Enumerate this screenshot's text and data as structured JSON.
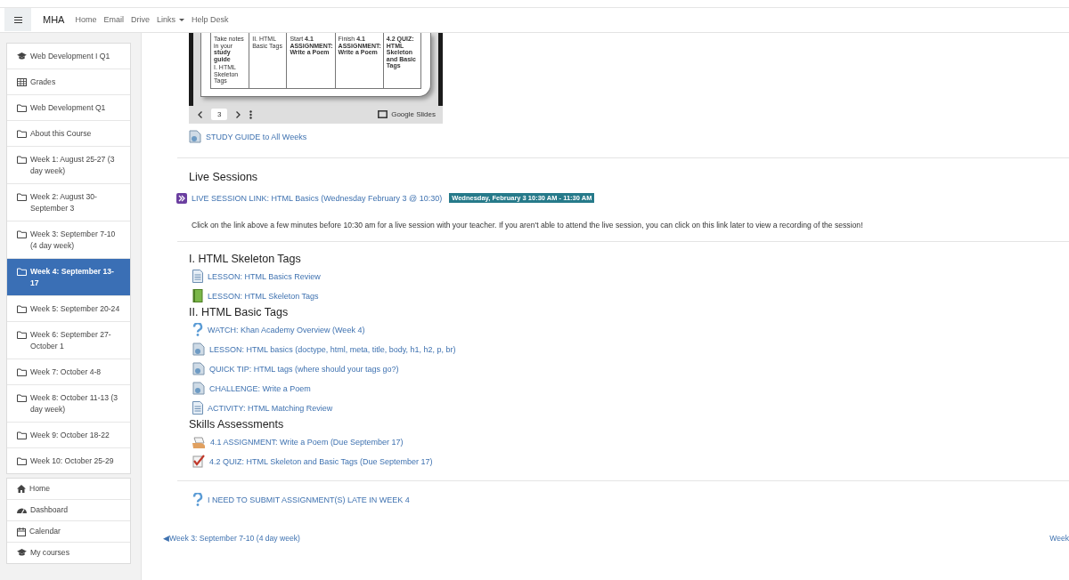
{
  "navbar": {
    "brand": "MHA",
    "links": [
      {
        "label": "Home",
        "dropdown": false
      },
      {
        "label": "Email",
        "dropdown": false
      },
      {
        "label": "Drive",
        "dropdown": false
      },
      {
        "label": "Links",
        "dropdown": true
      },
      {
        "label": "Help Desk",
        "dropdown": false
      }
    ]
  },
  "sidebar": {
    "course_items": [
      {
        "kind": "course",
        "label": "Web Development I Q1",
        "selected": false
      },
      {
        "kind": "grades",
        "label": "Grades",
        "selected": false
      },
      {
        "kind": "section",
        "label": "Web Development Q1",
        "selected": false
      },
      {
        "kind": "section",
        "label": "About this Course",
        "selected": false
      },
      {
        "kind": "section",
        "label": "Week 1: August 25-27 (3 day week)",
        "selected": false
      },
      {
        "kind": "section",
        "label": "Week 2: August 30-September 3",
        "selected": false
      },
      {
        "kind": "section",
        "label": "Week 3: September 7-10 (4 day week)",
        "selected": false
      },
      {
        "kind": "section",
        "label": "Week 4: September 13-17",
        "selected": true
      },
      {
        "kind": "section",
        "label": "Week 5: September 20-24",
        "selected": false
      },
      {
        "kind": "section",
        "label": "Week 6: September 27-October 1",
        "selected": false
      },
      {
        "kind": "section",
        "label": "Week 7: October 4-8",
        "selected": false
      },
      {
        "kind": "section",
        "label": "Week 8: October 11-13 (3 day week)",
        "selected": false
      },
      {
        "kind": "section",
        "label": "Week 9: October 18-22",
        "selected": false
      },
      {
        "kind": "section",
        "label": "Week 10: October 25-29",
        "selected": false
      }
    ],
    "site_items": [
      {
        "kind": "home",
        "label": "Home",
        "selected": false
      },
      {
        "kind": "dashboard",
        "label": "Dashboard",
        "selected": false
      },
      {
        "kind": "calendar",
        "label": "Calendar",
        "selected": false
      },
      {
        "kind": "course",
        "label": "My courses",
        "selected": false
      }
    ]
  },
  "slide": {
    "cells": [
      {
        "lines": [
          "Take notes in your **study guide**",
          "I. HTML Skeleton Tags"
        ]
      },
      {
        "lines": [
          "II. HTML Basic Tags"
        ]
      },
      {
        "lines": [
          "Start **4.1 ASSIGNMENT: Write a Poem**"
        ]
      },
      {
        "lines": [
          "Finish **4.1 ASSIGNMENT: Write a Poem**"
        ]
      },
      {
        "lines": [
          "**4.2 QUIZ: HTML Skeleton and Basic Tags**"
        ]
      }
    ],
    "page": "3",
    "brand": "Google Slides"
  },
  "study_guide": {
    "kind": "resource",
    "label": "STUDY GUIDE to All Weeks"
  },
  "live": {
    "title": "Live Sessions",
    "link": "LIVE SESSION LINK: HTML Basics (Wednesday February 3 @ 10:30)",
    "badge": "Wednesday, February 3 10:30 AM - 11:30 AM",
    "description": "Click on the link above a few minutes before 10:30 am for a live session with your teacher. If you aren't able to attend the live session, you can click on this link later to view a recording of the session!"
  },
  "sections": [
    {
      "title": "I. HTML Skeleton Tags",
      "items": [
        {
          "kind": "page",
          "label": "LESSON: HTML Basics Review"
        },
        {
          "kind": "book",
          "label": "LESSON: HTML Skeleton Tags"
        }
      ]
    },
    {
      "title": "II. HTML Basic Tags",
      "items": [
        {
          "kind": "question",
          "label": "WATCH: Khan Academy Overview (Week 4)"
        },
        {
          "kind": "resource",
          "label": "LESSON: HTML basics (doctype, html, meta, title, body, h1, h2, p, br)"
        },
        {
          "kind": "resource",
          "label": "QUICK TIP: HTML tags (where should your tags go?)"
        },
        {
          "kind": "resource",
          "label": "CHALLENGE: Write a Poem"
        },
        {
          "kind": "page",
          "label": "ACTIVITY: HTML Matching Review"
        }
      ]
    },
    {
      "title": "Skills Assessments",
      "items": [
        {
          "kind": "assignment",
          "label": "4.1 ASSIGNMENT: Write a Poem (Due September 17)"
        },
        {
          "kind": "quiz",
          "label": "4.2 QUIZ: HTML Skeleton and Basic Tags (Due September 17)"
        }
      ]
    }
  ],
  "late": {
    "kind": "question",
    "label": "I NEED TO SUBMIT ASSIGNMENT(S) LATE IN WEEK 4"
  },
  "nav": {
    "prev": "◀Week 3: September 7-10 (4 day week)",
    "next": "Week"
  }
}
